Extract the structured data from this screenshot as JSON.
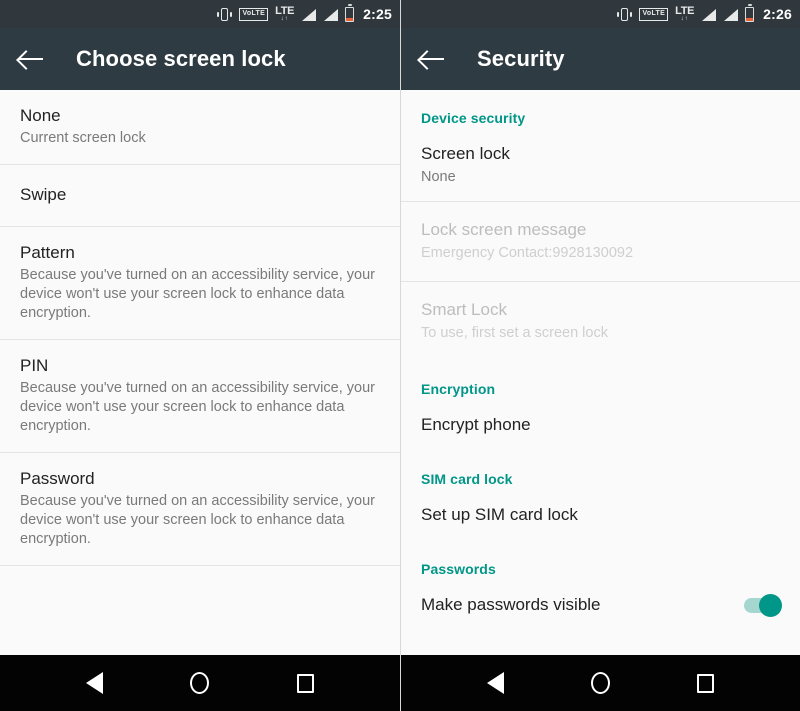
{
  "colors": {
    "statusbar_bg": "#30373d",
    "appbar_bg": "#2f3b42",
    "accent_teal": "#009688",
    "page_bg": "#fafafa",
    "navbar_bg": "#030303",
    "battery_low": "#e8623a"
  },
  "left_screen": {
    "statusbar": {
      "time": "2:25",
      "icons": [
        "vibrate-icon",
        "volte-icon",
        "lte-icon",
        "signal-icon",
        "signal-icon",
        "battery-icon"
      ],
      "volte_label": "VoLTE",
      "lte_label": "LTE",
      "lte_arrows": "↓↑"
    },
    "appbar": {
      "back_icon": "back-arrow-icon",
      "title": "Choose screen lock"
    },
    "lock_options": [
      {
        "title": "None",
        "sub": "Current screen lock"
      },
      {
        "title": "Swipe",
        "sub": ""
      },
      {
        "title": "Pattern",
        "sub": "Because you've turned on an accessibility service, your device won't use your screen lock to enhance data encryption."
      },
      {
        "title": "PIN",
        "sub": "Because you've turned on an accessibility service, your device won't use your screen lock to enhance data encryption."
      },
      {
        "title": "Password",
        "sub": "Because you've turned on an accessibility service, your device won't use your screen lock to enhance data encryption."
      }
    ]
  },
  "right_screen": {
    "statusbar": {
      "time": "2:26",
      "icons": [
        "vibrate-icon",
        "volte-icon",
        "lte-icon",
        "signal-icon",
        "signal-icon",
        "battery-icon"
      ],
      "volte_label": "VoLTE",
      "lte_label": "LTE",
      "lte_arrows": "↓↑"
    },
    "appbar": {
      "back_icon": "back-arrow-icon",
      "title": "Security"
    },
    "sections": [
      {
        "header": "Device security",
        "items": [
          {
            "title": "Screen lock",
            "sub": "None",
            "disabled": false
          },
          {
            "title": "Lock screen message",
            "sub": "Emergency Contact:9928130092",
            "disabled": true
          },
          {
            "title": "Smart Lock",
            "sub": "To use, first set a screen lock",
            "disabled": true
          }
        ]
      },
      {
        "header": "Encryption",
        "items": [
          {
            "title": "Encrypt phone",
            "sub": "",
            "disabled": false
          }
        ]
      },
      {
        "header": "SIM card lock",
        "items": [
          {
            "title": "Set up SIM card lock",
            "sub": "",
            "disabled": false
          }
        ]
      },
      {
        "header": "Passwords",
        "items": [
          {
            "title": "Make passwords visible",
            "sub": "",
            "disabled": false,
            "toggle": "on"
          }
        ]
      }
    ]
  },
  "navbar": {
    "back_label": "Back",
    "home_label": "Home",
    "recents_label": "Recents"
  }
}
